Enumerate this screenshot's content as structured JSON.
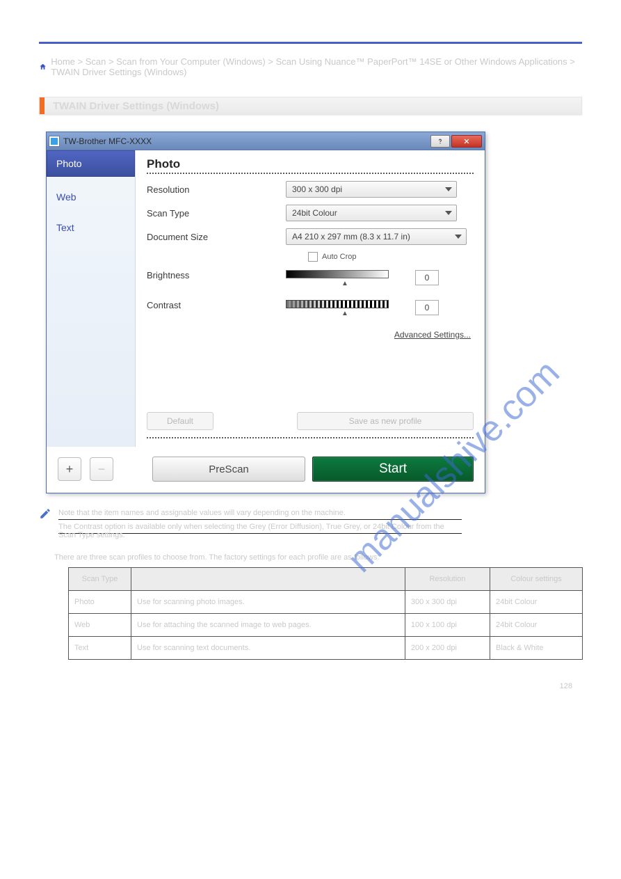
{
  "home_breadcrumb": "Home > Scan > Scan from Your Computer (Windows) > Scan Using Nuance™ PaperPort™ 14SE or Other Windows Applications > TWAIN Driver Settings (Windows)",
  "section_title": "TWAIN Driver Settings (Windows)",
  "dialog": {
    "title": "TW-Brother MFC-XXXX",
    "tabs": [
      "Photo",
      "Web",
      "Text"
    ],
    "active_tab": 0,
    "panel_heading": "Photo",
    "labels": {
      "resolution": "Resolution",
      "scan_type": "Scan Type",
      "document_size": "Document Size",
      "auto_crop": "Auto Crop",
      "brightness": "Brightness",
      "contrast": "Contrast",
      "advanced": "Advanced Settings...",
      "default": "Default",
      "save_profile": "Save as new profile",
      "prescan": "PreScan",
      "start": "Start",
      "plus": "+",
      "minus": "−"
    },
    "values": {
      "resolution": "300 x 300 dpi",
      "scan_type": "24bit Colour",
      "document_size": "A4 210 x 297 mm (8.3 x 11.7 in)",
      "brightness": "0",
      "contrast": "0"
    }
  },
  "note_line1": "Note that the item names and assignable values will vary depending on the machine.",
  "note_line2": "The Contrast option is available only when selecting the Grey (Error Diffusion), True Grey, or 24bit Colour from the Scan Type settings.",
  "intro_text": "There are three scan profiles to choose from. The factory settings for each profile are as follows:",
  "table": {
    "headers": [
      "Scan Type",
      "",
      "Resolution",
      "Colour settings"
    ],
    "rows": [
      [
        "Photo",
        "Use for scanning photo images.",
        "300 x 300 dpi",
        "24bit Colour"
      ],
      [
        "Web",
        "Use for attaching the scanned image to web pages.",
        "100 x 100 dpi",
        "24bit Colour"
      ],
      [
        "Text",
        "Use for scanning text documents.",
        "200 x 200 dpi",
        "Black & White"
      ]
    ]
  },
  "watermark": "manualshive.com",
  "page_number": "128"
}
